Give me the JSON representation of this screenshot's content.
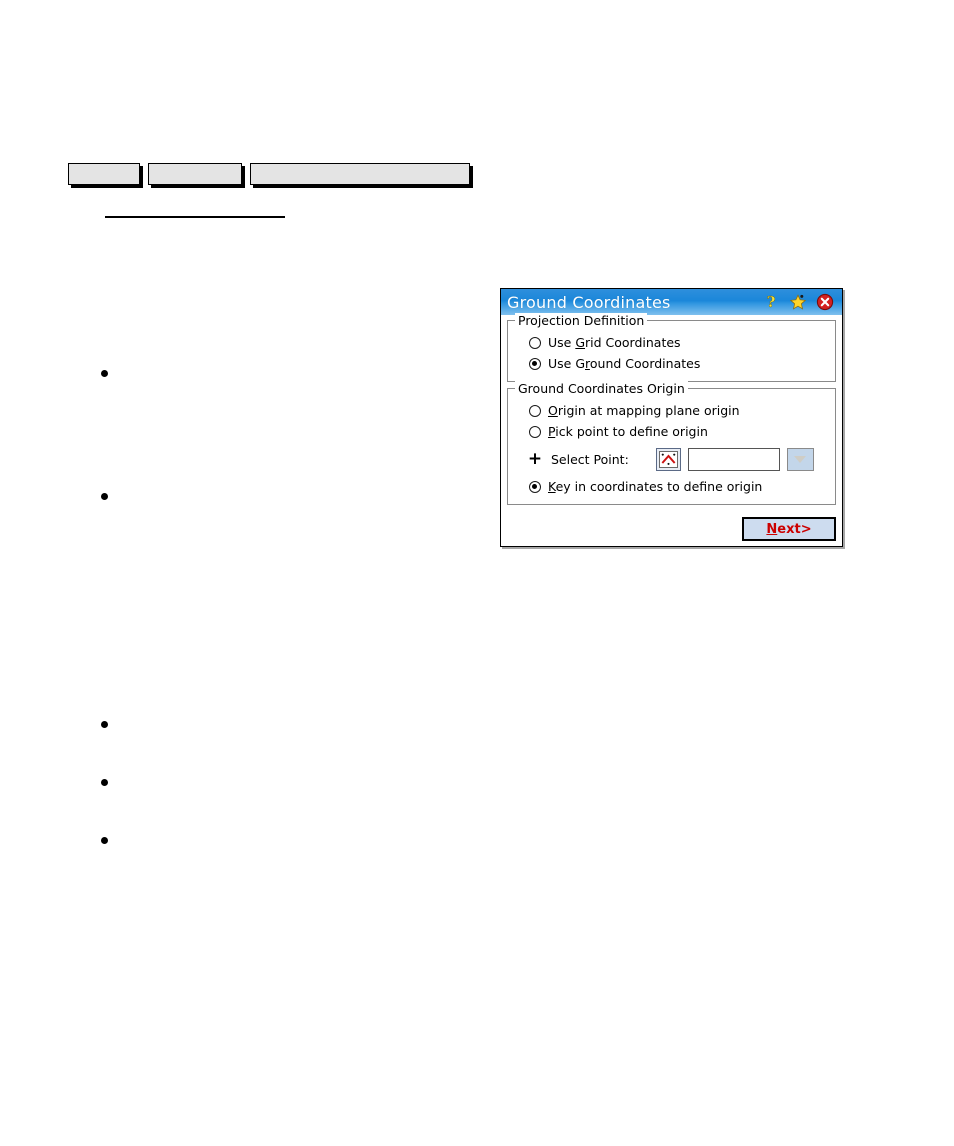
{
  "page": {
    "background_color": "#ffffff",
    "toolbar_buttons": [
      {
        "label": "",
        "name": "toolbar-button-1"
      },
      {
        "label": "",
        "name": "toolbar-button-2"
      },
      {
        "label": "",
        "name": "toolbar-button-3"
      }
    ],
    "divider_rule": "",
    "bullets": [
      {
        "text": ""
      },
      {
        "text": ""
      },
      {
        "text": ""
      },
      {
        "text": ""
      },
      {
        "text": ""
      }
    ]
  },
  "dialog": {
    "title": "Ground Coordinates",
    "title_bar_color": "#1b87da",
    "title_text_color": "#ffffff",
    "icons": {
      "help": "help-icon",
      "favorite": "star-icon",
      "close": "close-icon"
    },
    "groups": [
      {
        "legend": "Projection Definition",
        "options": [
          {
            "label": "Use Grid Coordinates",
            "accel_before": "Use ",
            "accel": "G",
            "accel_after": "rid Coordinates",
            "selected": false
          },
          {
            "label": "Use Ground Coordinates",
            "accel_before": "Use G",
            "accel": "r",
            "accel_after": "ound Coordinates",
            "selected": true
          }
        ]
      },
      {
        "legend": "Ground Coordinates Origin",
        "options": [
          {
            "label": "Origin at mapping plane origin",
            "accel_before": "",
            "accel": "O",
            "accel_after": "rigin at mapping plane origin",
            "selected": false
          },
          {
            "label": "Pick point to define origin",
            "accel_before": "",
            "accel": "P",
            "accel_after": "ick point to define origin",
            "selected": false
          },
          {
            "label": "Key in coordinates to define origin",
            "accel_before": "",
            "accel": "K",
            "accel_after": "ey in coordinates to define origin",
            "selected": true
          }
        ],
        "select_point": {
          "label": "Select Point:",
          "plus_glyph": "+",
          "pick_icon": "pick-point-icon",
          "input_value": "",
          "input_placeholder": "",
          "dropdown_icon": "chevron-down-icon"
        }
      }
    ],
    "footer": {
      "next_label": "Next>",
      "next_accel": "N",
      "next_accel_after": "ext>",
      "next_text_color": "#cc0000",
      "next_fill_color": "#cddcef"
    }
  }
}
